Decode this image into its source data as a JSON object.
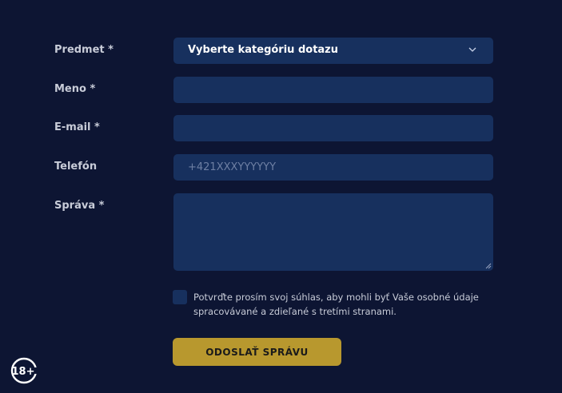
{
  "form": {
    "subject": {
      "label": "Predmet *",
      "selected": "Vyberte kategóriu dotazu"
    },
    "name": {
      "label": "Meno *",
      "value": ""
    },
    "email": {
      "label": "E-mail *",
      "value": ""
    },
    "phone": {
      "label": "Telefón",
      "placeholder": "+421XXXYYYYYY"
    },
    "message": {
      "label": "Správa *",
      "value": ""
    },
    "consent_text": "Potvrďte prosím svoj súhlas, aby mohli byť Vaše osobné údaje spracovávané a zdieľané s tretími stranami.",
    "submit_label": "ODOSLAŤ SPRÁVU"
  },
  "badge": {
    "age": "18+"
  },
  "colors": {
    "background": "#0d1533",
    "field": "#17305e",
    "accent": "#b8982e",
    "label": "#c8ccd8"
  },
  "icons": {
    "dropdown": "chevron-down-icon",
    "age_restriction": "age-18-plus-icon"
  }
}
